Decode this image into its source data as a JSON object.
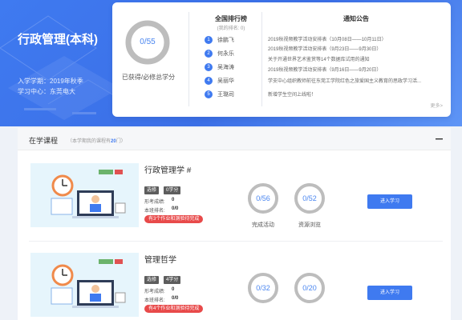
{
  "hero": {
    "major": "行政管理(本科)",
    "term": "入学学期：2019年秋季",
    "center": "学习中心：东莞电大"
  },
  "credits": {
    "ring_text": "0/55",
    "caption": "已获得/必修总学分",
    "progress": 0
  },
  "ranking": {
    "title": "全国排行榜",
    "subtitle": "(我的排名: 0)",
    "items": [
      {
        "rank": "1",
        "name": "徐鹏飞"
      },
      {
        "rank": "2",
        "name": "何永乐"
      },
      {
        "rank": "3",
        "name": "吴海涛"
      },
      {
        "rank": "4",
        "name": "吴丽华"
      },
      {
        "rank": "5",
        "name": "王璐司"
      }
    ]
  },
  "notices": {
    "title": "通知公告",
    "items": [
      "2019秋视频教学活动安排表（10月08日——10月11日）",
      "2019秋视频教学活动安排表（9月23日——9月30日）",
      "关于开通世界艺术鉴赏等14个数据库试用的通知",
      "2019秋视频教学活动安排表（9月16日——9月20日）",
      "学支中心组织教师前往东莞工学院红色之旅爱国主义教育的思政学习活...",
      "新增学生空间上线啦！"
    ],
    "more": "更多>"
  },
  "courses": {
    "header_title": "在学课程",
    "header_sub_prefix": "（本学期我的课程有",
    "header_count": "20",
    "header_sub_suffix": "门）",
    "items": [
      {
        "name": "行政管理学 #",
        "tag_type": "选修",
        "tag_credit": "0学分",
        "score_label": "形考成绩:",
        "score_value": "0",
        "rank_label": "本班排名:",
        "rank_value": "0/0",
        "alert": "有3个作业和测验待完成",
        "activity_ring": "0/56",
        "activity_label": "完成活动",
        "resource_ring": "0/52",
        "resource_label": "资源浏览",
        "button": "进入学习"
      },
      {
        "name": "管理哲学",
        "tag_type": "选修",
        "tag_credit": "4学分",
        "score_label": "形考成绩:",
        "score_value": "0",
        "rank_label": "本班排名:",
        "rank_value": "0/0",
        "alert": "有4个作业和测验待完成",
        "activity_ring": "0/32",
        "activity_label": "完成活动",
        "resource_ring": "0/20",
        "resource_label": "资源浏览",
        "button": "进入学习"
      }
    ]
  },
  "colors": {
    "accent": "#3f7af0",
    "alert": "#e84a4a",
    "ring": "#bdbdbd"
  }
}
